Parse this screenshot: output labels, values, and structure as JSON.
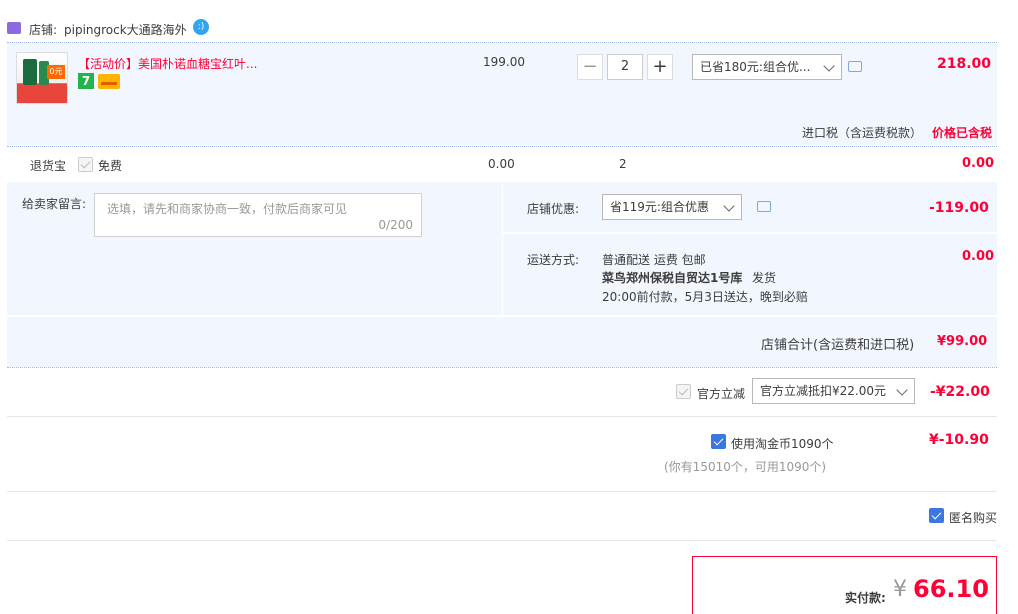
{
  "shop": {
    "label": "店铺:",
    "name": "pipingrock大通路海外"
  },
  "item": {
    "title": "【活动价】美国朴诺血糖宝红叶...",
    "price": "199.00",
    "quantity": "2",
    "discount_select": "已省180元:组合优...",
    "subtotal": "218.00",
    "tax_label": "进口税（含运费税款）",
    "tax_value": "价格已含税"
  },
  "return_insurance": {
    "label": "退货宝",
    "option": "免费",
    "price": "0.00",
    "qty": "2",
    "total": "0.00"
  },
  "message": {
    "label": "给卖家留言:",
    "placeholder": "选填，请先和商家协商一致，付款后商家可见",
    "counter": "0/200"
  },
  "shop_discount": {
    "label": "店铺优惠:",
    "select": "省119元:组合优惠",
    "value": "-119.00"
  },
  "shipping": {
    "label": "运送方式:",
    "line1": "普通配送 运费 包邮",
    "warehouse": "菜鸟郑州保税自贸达1号库",
    "ship_word": "发货",
    "line3": "20:00前付款，5月3日送达，晚到必赔",
    "value": "0.00"
  },
  "shop_total": {
    "label": "店铺合计(含运费和进口税)",
    "value": "¥99.00"
  },
  "official_discount": {
    "label": "官方立减",
    "select": "官方立减抵扣¥22.00元",
    "value": "-¥22.00"
  },
  "coins": {
    "label": "使用淘金币1090个",
    "note": "(你有15010个，可用1090个)",
    "value": "¥-10.90"
  },
  "anonymous": {
    "label": "匿名购买"
  },
  "payment": {
    "label": "实付款:",
    "currency": "¥",
    "value": "66.10"
  },
  "colors": {
    "accent": "#ff0036",
    "panel": "#f2f7ff",
    "check": "#3a77e0"
  }
}
